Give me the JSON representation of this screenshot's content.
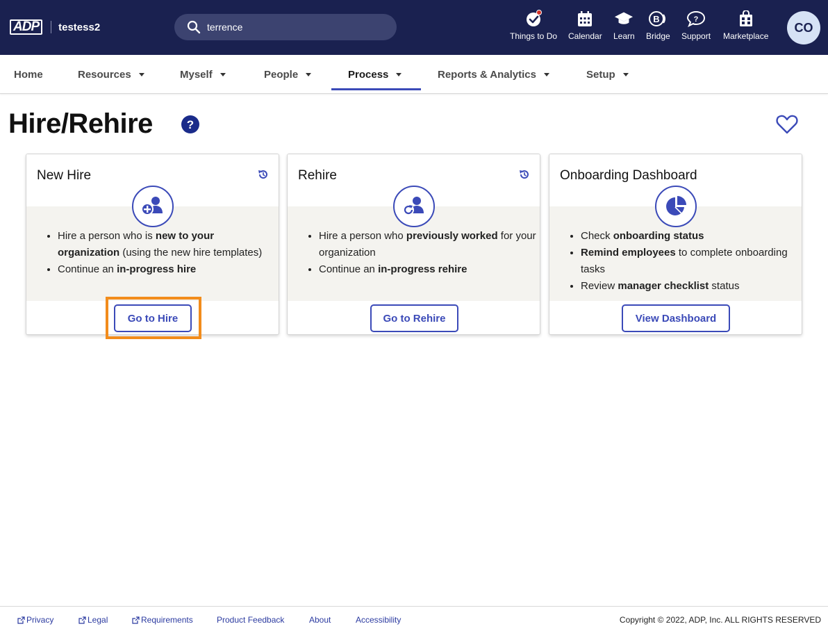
{
  "header": {
    "logo_text": "ADP",
    "company": "testess2",
    "search": {
      "value": "terrence",
      "placeholder": ""
    },
    "nav_icons": [
      {
        "label": "Things to Do",
        "icon": "check-badge-icon"
      },
      {
        "label": "Calendar",
        "icon": "calendar-icon"
      },
      {
        "label": "Learn",
        "icon": "graduation-cap-icon"
      },
      {
        "label": "Bridge",
        "icon": "bridge-icon"
      },
      {
        "label": "Support",
        "icon": "chat-question-icon"
      },
      {
        "label": "Marketplace",
        "icon": "marketplace-bag-icon"
      }
    ],
    "avatar_initials": "CO"
  },
  "subnav": {
    "tabs": [
      {
        "label": "Home",
        "dropdown": false
      },
      {
        "label": "Resources",
        "dropdown": true
      },
      {
        "label": "Myself",
        "dropdown": true
      },
      {
        "label": "People",
        "dropdown": true
      },
      {
        "label": "Process",
        "dropdown": true,
        "active": true
      },
      {
        "label": "Reports & Analytics",
        "dropdown": true
      },
      {
        "label": "Setup",
        "dropdown": true
      }
    ]
  },
  "page": {
    "title": "Hire/Rehire"
  },
  "cards": [
    {
      "title": "New Hire",
      "icon": "add-person-icon",
      "button": "Go to Hire",
      "bullets": [
        {
          "parts": [
            "Hire a person who is ",
            "new to your organization",
            " (using the new hire templates)"
          ]
        },
        {
          "parts": [
            "Continue an ",
            "in-progress hire",
            ""
          ]
        }
      ]
    },
    {
      "title": "Rehire",
      "icon": "rehire-person-icon",
      "button": "Go to Rehire",
      "bullets": [
        {
          "parts": [
            "Hire a person who ",
            "previously worked",
            " for your organization"
          ]
        },
        {
          "parts": [
            "Continue an ",
            "in-progress rehire",
            ""
          ]
        }
      ]
    },
    {
      "title": "Onboarding Dashboard",
      "icon": "pie-chart-icon",
      "button": "View Dashboard",
      "bullets": [
        {
          "parts": [
            "Check ",
            "onboarding status",
            ""
          ]
        },
        {
          "parts": [
            "",
            "Remind employees",
            " to complete onboarding tasks"
          ]
        },
        {
          "parts": [
            "Review ",
            "manager checklist",
            " status"
          ]
        }
      ]
    }
  ],
  "footer": {
    "links": [
      "Privacy",
      "Legal",
      "Requirements",
      "Product Feedback",
      "About",
      "Accessibility"
    ],
    "copyright": "Copyright © 2022, ADP, Inc. ALL RIGHTS RESERVED"
  },
  "colors": {
    "header_bg": "#1a2150",
    "accent": "#3b4ab8",
    "highlight": "#f28c1c",
    "card_band": "#f4f3ef"
  }
}
